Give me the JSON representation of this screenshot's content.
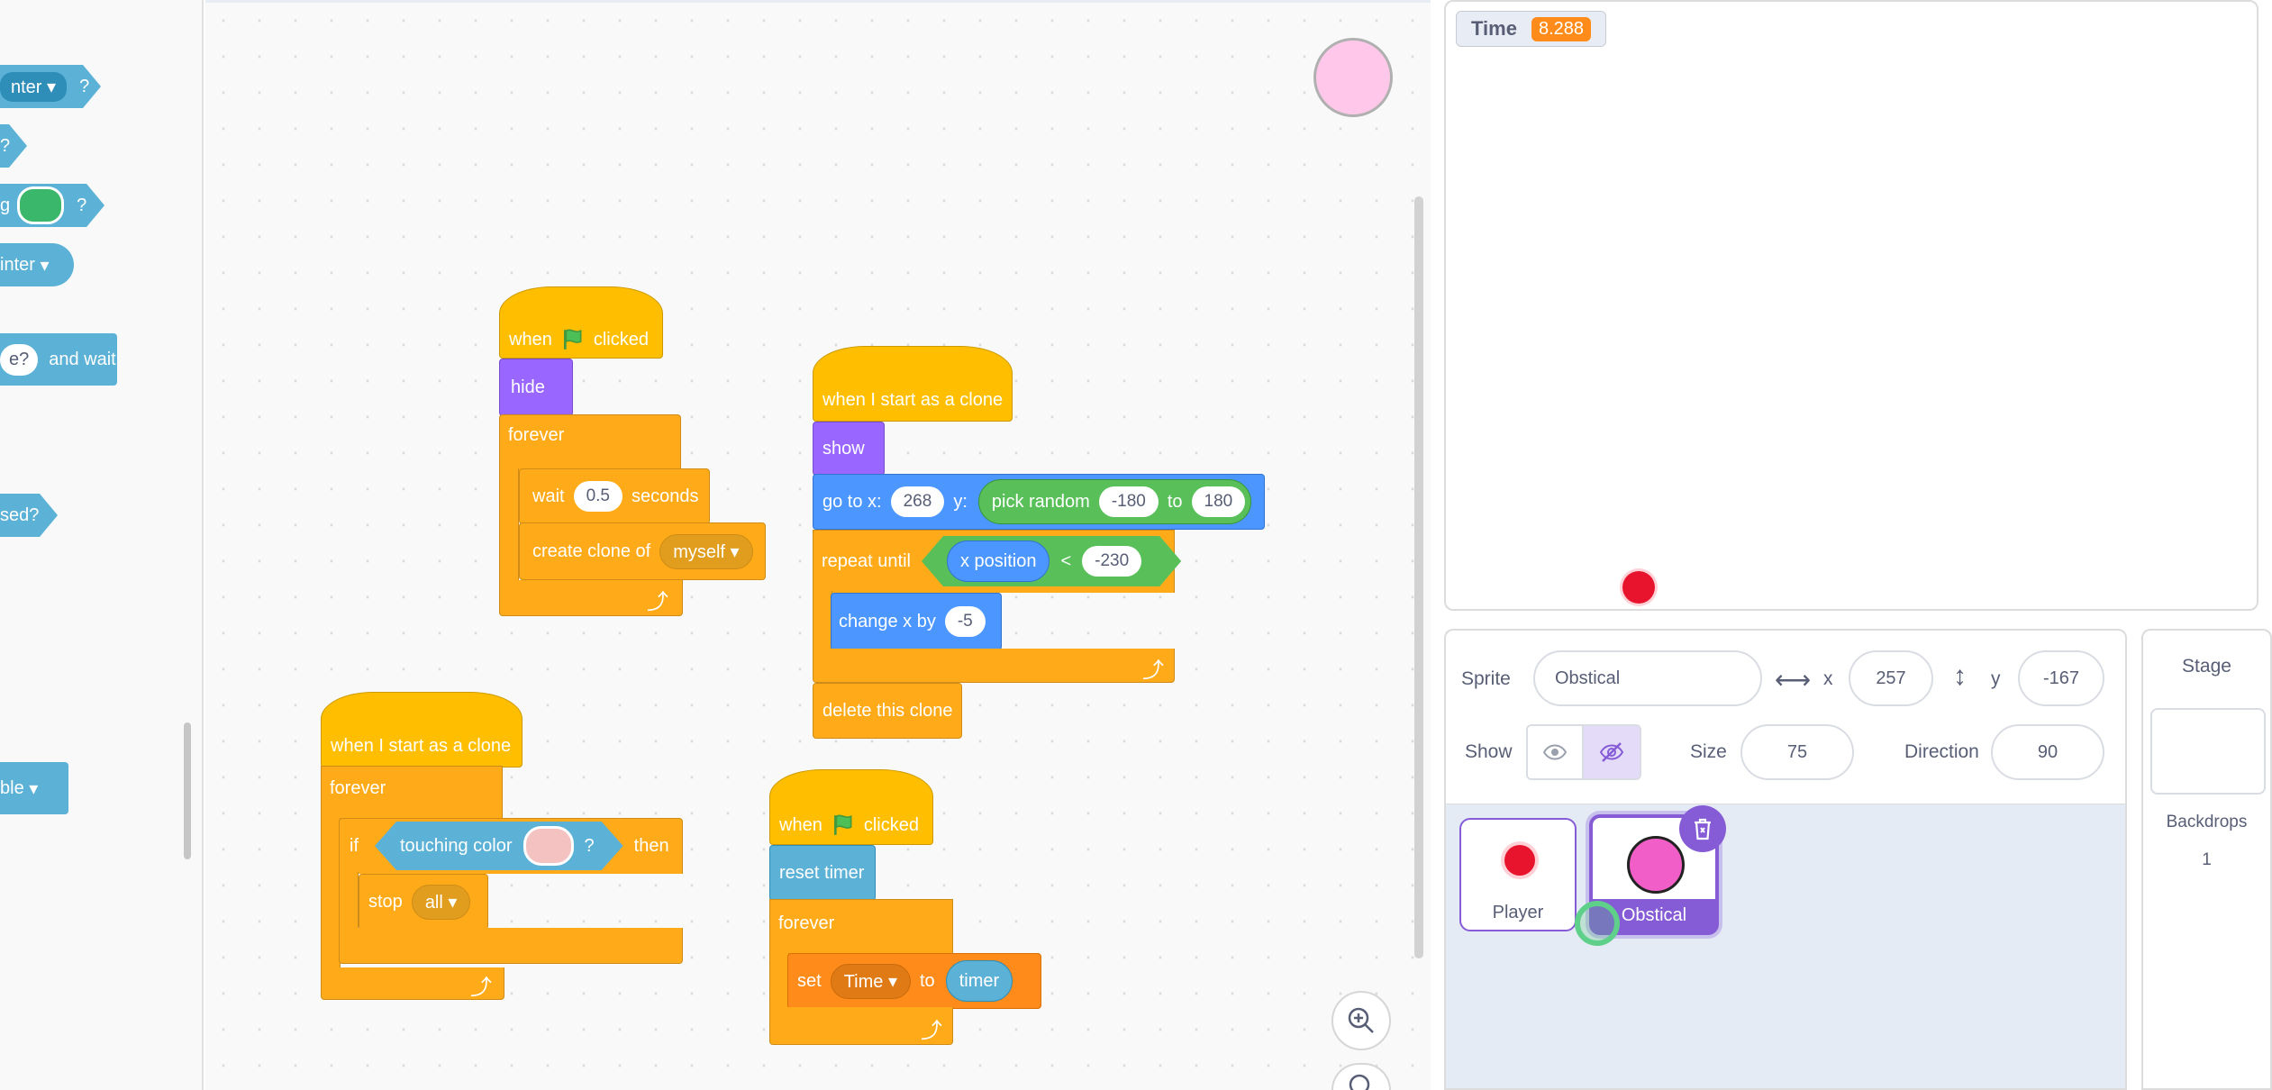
{
  "palette": {
    "items": [
      "nter",
      "?",
      "g",
      "?",
      "inter",
      "e?",
      "and wait",
      "sed?",
      "ble"
    ]
  },
  "scripts": {
    "flag_script": {
      "when": "when",
      "clicked": "clicked",
      "hide": "hide",
      "forever": "forever",
      "wait": "wait",
      "wait_value": "0.5",
      "seconds": "seconds",
      "create_clone": "create clone of",
      "clone_target": "myself"
    },
    "clone_move": {
      "hat": "when I start as a clone",
      "show": "show",
      "goto": "go to x:",
      "x_value": "268",
      "y_label": "y:",
      "pick_random": "pick random",
      "rand_from": "-180",
      "to": "to",
      "rand_to": "180",
      "repeat_until": "repeat until",
      "x_position": "x position",
      "lt": "<",
      "limit": "-230",
      "change_x": "change x by",
      "change_value": "-5",
      "delete": "delete this clone"
    },
    "clone_touch": {
      "hat": "when I start as a clone",
      "forever": "forever",
      "if": "if",
      "touching_color": "touching color",
      "q": "?",
      "then": "then",
      "stop": "stop",
      "stop_option": "all"
    },
    "timer_script": {
      "when": "when",
      "clicked": "clicked",
      "reset_timer": "reset timer",
      "forever": "forever",
      "set": "set",
      "variable": "Time",
      "to": "to",
      "timer": "timer"
    }
  },
  "stage": {
    "monitor_label": "Time",
    "monitor_value": "8.288"
  },
  "sprite_info": {
    "sprite_label": "Sprite",
    "sprite_name": "Obstical",
    "x_label": "x",
    "x_value": "257",
    "y_label": "y",
    "y_value": "-167",
    "show_label": "Show",
    "size_label": "Size",
    "size_value": "75",
    "direction_label": "Direction",
    "direction_value": "90"
  },
  "sprites": [
    {
      "name": "Player",
      "color": "#e8132d"
    },
    {
      "name": "Obstical",
      "color": "#f25ec7"
    }
  ],
  "stage_pane": {
    "title": "Stage",
    "backdrops_label": "Backdrops",
    "backdrops_count": "1"
  },
  "colors": {
    "events": "#ffbf00",
    "looks": "#9966ff",
    "control": "#ffab19",
    "motion": "#4c97ff",
    "operators": "#59c059",
    "sensing": "#5cb1d6",
    "variables": "#ff8c1a",
    "selected_sprite": "#855cd6"
  }
}
